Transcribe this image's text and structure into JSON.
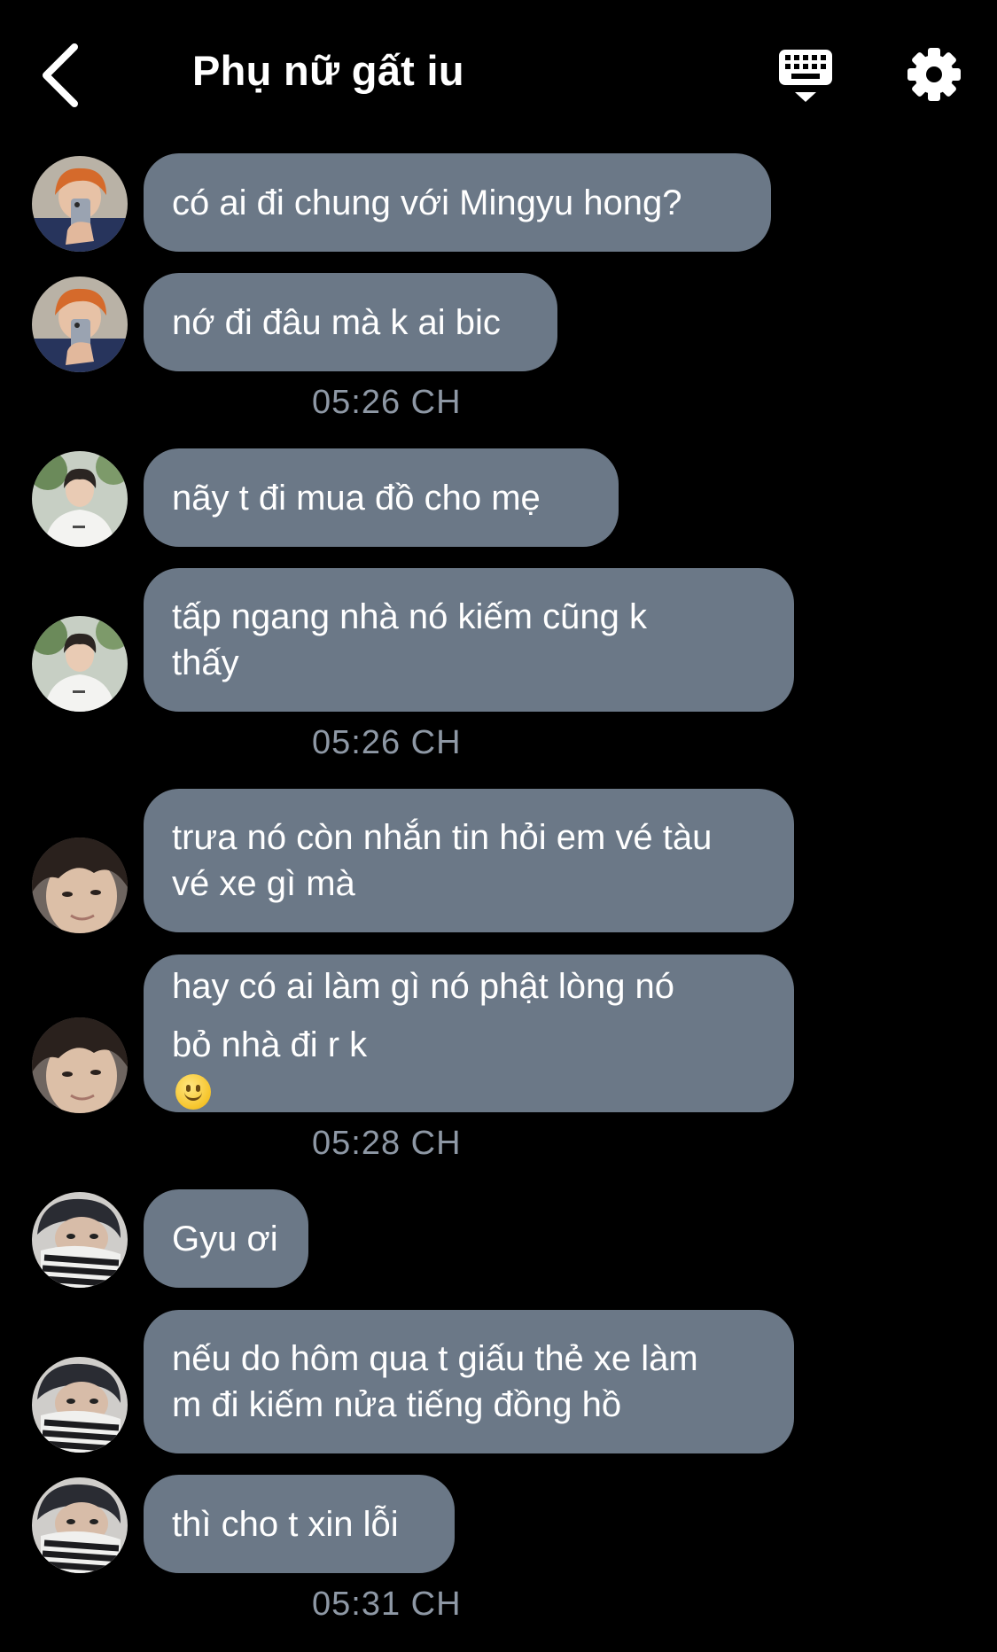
{
  "header": {
    "title": "Phụ nữ gất iu",
    "back_icon": "chevron-left-icon",
    "keyboard_icon": "keyboard-icon",
    "settings_icon": "gear-icon"
  },
  "colors": {
    "background": "#000000",
    "bubble": "#6b7887",
    "timestamp": "#8e98a5",
    "text": "#ffffff"
  },
  "messages": [
    {
      "text": "có ai đi chung với Mingyu hong?"
    },
    {
      "text": "nớ đi đâu mà k ai bic"
    },
    {
      "time": "05:26 CH"
    },
    {
      "text": "nãy t đi mua đồ cho mẹ"
    },
    {
      "line1": "tấp ngang nhà nó kiếm cũng k",
      "line2": "thấy"
    },
    {
      "time": "05:26 CH"
    },
    {
      "line1": "trưa nó còn nhắn tin hỏi em vé tàu",
      "line2": "vé xe gì mà"
    },
    {
      "line1": "hay có ai làm gì nó phật lòng nó",
      "line2": "bỏ nhà đi r k",
      "emoji": "slightly-smiling-face-emoji"
    },
    {
      "time": "05:28 CH"
    },
    {
      "text": "Gyu ơi"
    },
    {
      "line1": "nếu do hôm qua t giấu thẻ xe làm",
      "line2": "m đi kiếm nửa tiếng đồng hồ"
    },
    {
      "text": "thì cho t xin lỗi"
    },
    {
      "time": "05:31 CH"
    }
  ]
}
